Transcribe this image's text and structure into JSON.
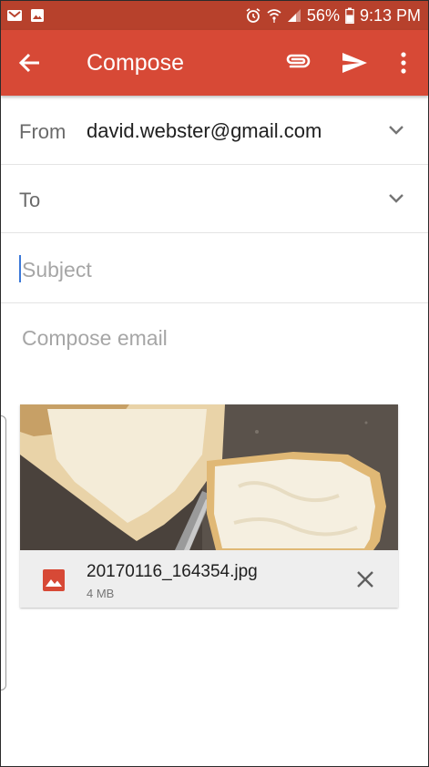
{
  "status_bar": {
    "battery": "56%",
    "time": "9:13 PM"
  },
  "header": {
    "title": "Compose"
  },
  "form": {
    "from_label": "From",
    "from_value": "david.webster@gmail.com",
    "to_label": "To",
    "to_value": "",
    "subject_placeholder": "Subject",
    "subject_value": "",
    "body_placeholder": "Compose email",
    "body_value": ""
  },
  "attachment": {
    "filename": "20170116_164354.jpg",
    "size": "4 MB"
  },
  "icons": {
    "status_left": [
      "gmail-notification-icon",
      "image-notification-icon"
    ],
    "status_right": [
      "alarm-icon",
      "wifi-icon",
      "signal-icon",
      "battery-icon"
    ],
    "toolbar": [
      "back-arrow-icon",
      "paperclip-icon",
      "send-icon",
      "more-vert-icon"
    ],
    "fields": [
      "chevron-down-icon",
      "chevron-down-icon"
    ],
    "attachment": [
      "image-file-icon",
      "close-icon"
    ]
  },
  "colors": {
    "status_bar": "#b7412c",
    "app_bar": "#d74936",
    "cursor": "#3b78d8",
    "attachment_icon": "#d74936"
  }
}
